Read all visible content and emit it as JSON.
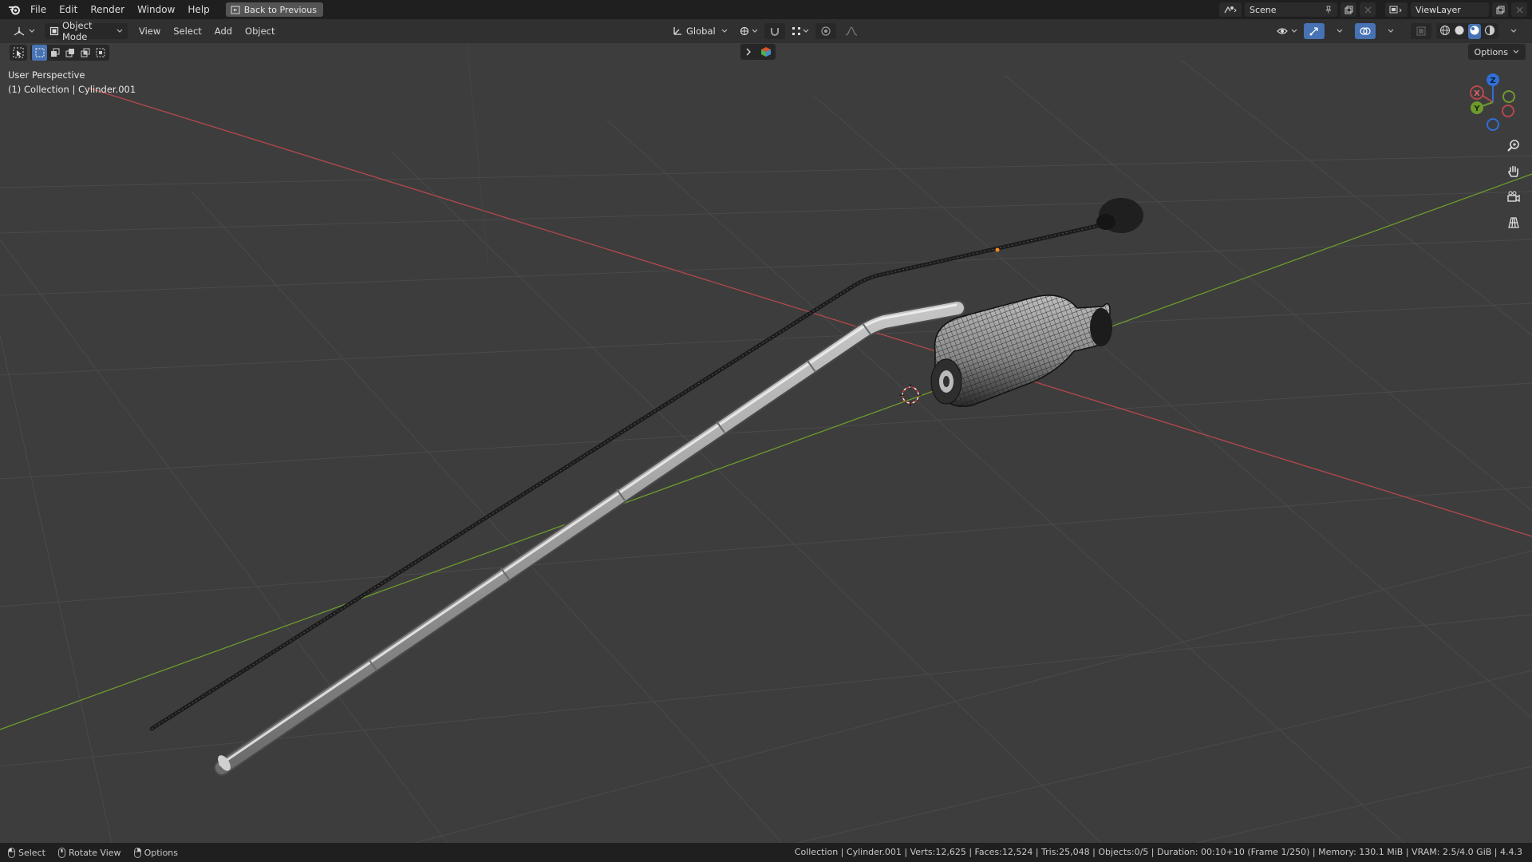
{
  "menubar": {
    "items": [
      "File",
      "Edit",
      "Render",
      "Window",
      "Help"
    ],
    "back_button": "Back to Previous",
    "scene_label": "Scene",
    "viewlayer_label": "ViewLayer"
  },
  "header": {
    "mode": "Object Mode",
    "menus": [
      "View",
      "Select",
      "Add",
      "Object"
    ],
    "transform_orientation": "Global",
    "options_label": "Options"
  },
  "viewport": {
    "perspective_label": "User Perspective",
    "collection_label": "(1) Collection | Cylinder.001",
    "gizmo_axes": [
      "X",
      "Y",
      "Z"
    ]
  },
  "statusbar": {
    "hints": [
      "Select",
      "Rotate View",
      "Options"
    ],
    "info": "Collection | Cylinder.001 | Verts:12,625 | Faces:12,524 | Tris:25,048 | Objects:0/5 | Duration: 00:10+10 (Frame 1/250) | Memory: 130.1 MiB | VRAM: 2.5/4.0 GiB | 4.4.3"
  },
  "colors": {
    "x_axis": "#b5484b",
    "y_axis": "#6e9a2d",
    "z_axis": "#2f6fd8",
    "accent": "#4772b3"
  }
}
